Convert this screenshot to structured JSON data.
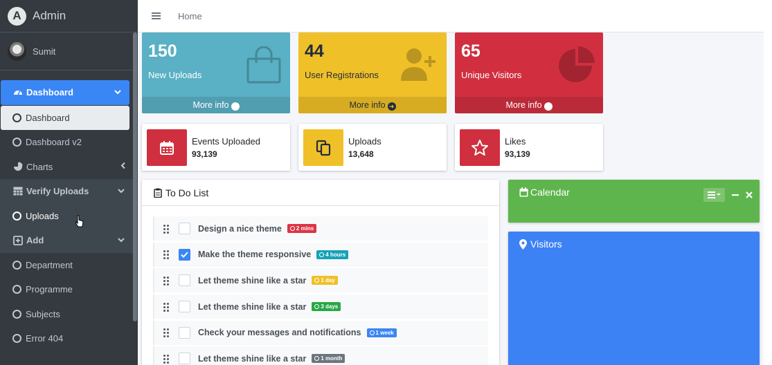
{
  "brand": {
    "name": "Admin",
    "logo_letter": "A"
  },
  "user": {
    "name": "Sumit"
  },
  "sidebar": {
    "items": [
      {
        "label": "Dashboard",
        "icon": "tachometer-icon"
      },
      {
        "label": "Dashboard"
      },
      {
        "label": "Dashboard v2"
      },
      {
        "label": "Charts",
        "icon": "pie-chart-icon"
      },
      {
        "label": "Verify Uploads",
        "icon": "table-icon"
      },
      {
        "label": "Uploads"
      },
      {
        "label": "Add",
        "icon": "plus-square-icon"
      },
      {
        "label": "Department"
      },
      {
        "label": "Programme"
      },
      {
        "label": "Subjects"
      },
      {
        "label": "Error 404"
      }
    ]
  },
  "header": {
    "breadcrumb": "Home"
  },
  "small_boxes": [
    {
      "value": "150",
      "label": "New Uploads",
      "footer": "More info",
      "color": "#5ab0c4",
      "icon": "shopping-bag-icon"
    },
    {
      "value": "44",
      "label": "User Registrations",
      "footer": "More info",
      "color": "#f0c028",
      "icon": "user-plus-icon"
    },
    {
      "value": "65",
      "label": "Unique Visitors",
      "footer": "More info",
      "color": "#d12f3f",
      "icon": "pie-chart-icon"
    }
  ],
  "info_boxes": [
    {
      "title": "Events Uploaded",
      "value": "93,139",
      "color": "#cf2f3e",
      "icon": "calendar-icon"
    },
    {
      "title": "Uploads",
      "value": "13,648",
      "color": "#f0c028",
      "icon": "copy-icon"
    },
    {
      "title": "Likes",
      "value": "93,139",
      "color": "#cf2f3e",
      "icon": "star-icon"
    }
  ],
  "todo": {
    "title": "To Do List",
    "items": [
      {
        "text": "Design a nice theme",
        "badge": "2 mins",
        "badge_color": "#dc3545",
        "checked": false
      },
      {
        "text": "Make the theme responsive",
        "badge": "4 hours",
        "badge_color": "#17a2b8",
        "checked": true
      },
      {
        "text": "Let theme shine like a star",
        "badge": "1 day",
        "badge_color": "#f0c028",
        "checked": false
      },
      {
        "text": "Let theme shine like a star",
        "badge": "3 days",
        "badge_color": "#28a745",
        "checked": false
      },
      {
        "text": "Check your messages and notifications",
        "badge": "1 week",
        "badge_color": "#3a86f5",
        "checked": false
      },
      {
        "text": "Let theme shine like a star",
        "badge": "1 month",
        "badge_color": "#6c757d",
        "checked": false
      }
    ]
  },
  "calendar": {
    "title": "Calendar"
  },
  "visitors": {
    "title": "Visitors"
  }
}
